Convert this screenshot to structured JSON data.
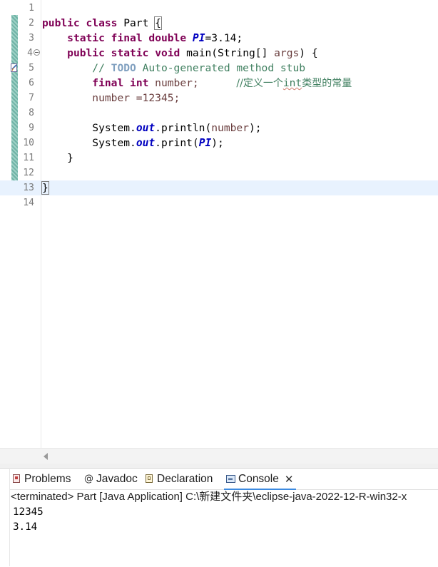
{
  "editor": {
    "lines": [
      {
        "num": "1"
      },
      {
        "num": "2",
        "t1": "public",
        "t2": "class",
        "t3": " Part ",
        "t4": "{"
      },
      {
        "num": "3",
        "t1": "static",
        "t2": "final",
        "t3": "double",
        "t4": "PI",
        "t5": "=3.14;"
      },
      {
        "num": "4",
        "t1": "public",
        "t2": "static",
        "t3": "void",
        "t4": " main(String[] ",
        "t5": "args",
        "t6": ") {"
      },
      {
        "num": "5",
        "t1": "// ",
        "t2": "TODO",
        "t3": " Auto-generated method stub"
      },
      {
        "num": "6",
        "t1": "final",
        "t2": "int",
        "t3": " number;",
        "t4": "//定义一个",
        "t5": "int",
        "t6": "类型的常量"
      },
      {
        "num": "7",
        "t1": "number =12345;"
      },
      {
        "num": "8"
      },
      {
        "num": "9",
        "t1": "System.",
        "t2": "out",
        "t3": ".println(",
        "t4": "number",
        "t5": ");"
      },
      {
        "num": "10",
        "t1": "System.",
        "t2": "out",
        "t3": ".print(",
        "t4": "PI",
        "t5": ");"
      },
      {
        "num": "11",
        "t1": "}"
      },
      {
        "num": "12"
      },
      {
        "num": "13",
        "t1": "}"
      },
      {
        "num": "14"
      }
    ]
  },
  "panel": {
    "tabs": {
      "problems": "Problems",
      "javadoc_icon": "@",
      "javadoc": "Javadoc",
      "declaration": "Declaration",
      "console": "Console",
      "close": "✕"
    },
    "status": "<terminated> Part [Java Application] C:\\新建文件夹\\eclipse-java-2022-12-R-win32-x",
    "output": [
      "12345",
      "3.14"
    ]
  },
  "colors": {
    "keyword": "#7f0055",
    "static_field": "#0000c0",
    "comment": "#3f7f5f",
    "current_line": "#e8f2fe",
    "active_tab_underline": "#3c8ae0"
  },
  "icons": [
    "problems-icon",
    "javadoc-icon",
    "declaration-icon",
    "console-icon",
    "close-icon",
    "fold-collapse-icon",
    "task-marker-icon",
    "scroll-left-arrow-icon"
  ]
}
